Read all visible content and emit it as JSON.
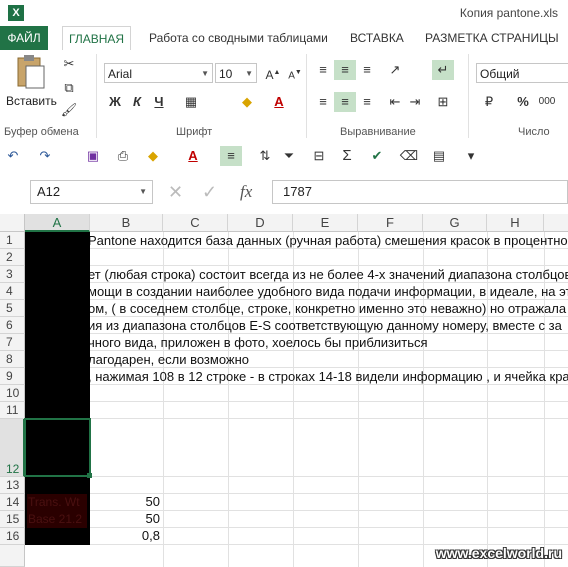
{
  "app": {
    "icon_label": "X",
    "window_title": "Копия pantone.xls"
  },
  "tabs": [
    "ФАЙЛ",
    "ГЛАВНАЯ",
    "Работа со сводными таблицами",
    "ВСТАВКА",
    "РАЗМЕТКА СТРАНИЦЫ"
  ],
  "ribbon": {
    "paste_label": "Вставить",
    "font_name": "Arial",
    "font_size": "10",
    "number_format": "Общий",
    "groups": [
      "Буфер обмена",
      "Шрифт",
      "Выравнивание",
      "Число"
    ],
    "bold": "Ж",
    "italic": "К",
    "underline": "Ч",
    "percent": "%",
    "thousands": "000"
  },
  "formula_bar": {
    "name_box": "A12",
    "fx": "fx",
    "value": "1787"
  },
  "columns": [
    "A",
    "B",
    "C",
    "D",
    "E",
    "F",
    "G",
    "H"
  ],
  "rows": [
    "1",
    "2",
    "3",
    "4",
    "5",
    "6",
    "7",
    "8",
    "9",
    "10",
    "11",
    "12",
    "13",
    "14",
    "15",
    "16"
  ],
  "cells": {
    "r1": "Pantone находится база данных (ручная работа) смешения красок в процентном",
    "r3": "ет (любая строка) состоит всегда из не более 4-х значений диапазона столбцов",
    "r4": "мощи в создании наиболее удобного вида подачи информации, в идеале, на эт",
    "r5": "ом, ( в соседнем столбце, строке, конкретно именно это неважно) но отражала",
    "r6": "ия из диапазона столбцов E-S соответствующую данному номеру, вместе с за",
    "r7": "чного вида, приложен в фото, хоелось бы приблизиться",
    "r8": "лагодарен, если возможно",
    "r9": ", нажимая 108 в 12 строке - в строках 14-18 видели информацию , и ячейка кра",
    "r14_a": "Trans. Wt",
    "r15_a": "Base 21.2",
    "b14": "50",
    "b15": "50",
    "b16": "0,8"
  },
  "watermark": "www.excelworld.ru"
}
